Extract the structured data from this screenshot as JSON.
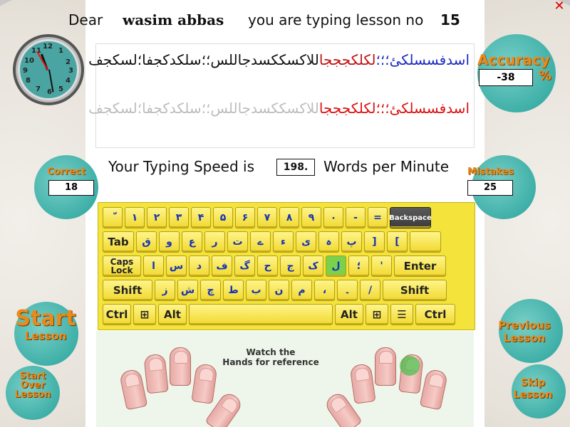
{
  "header": {
    "dear": "Dear",
    "user_name": "wasim abbas",
    "you_are": "you are typing lesson no",
    "lesson_number": "15"
  },
  "window": {
    "close_icon": "close-icon"
  },
  "text_panel": {
    "typed_blue": "اسدفسسلکئ؛؛؛",
    "typed_red": "لکلکجججا",
    "typed_black": "للاکسککسدجاللس؛؛سلکدکجفا؛لسکجف",
    "source_red": "اسدفسسلکئ؛؛؛لکلکجججا",
    "source_grey": "للاکسککسدجاللس؛؛سلکدکجفا؛لسکجف"
  },
  "speed": {
    "label": "Your Typing Speed is",
    "value": "198.",
    "unit": "Words per Minute"
  },
  "accuracy": {
    "label": "Accuracy",
    "value": "-38",
    "percent": "%"
  },
  "correct": {
    "label": "Correct",
    "value": "18"
  },
  "mistakes": {
    "label": "Mistakes",
    "value": "25"
  },
  "keyboard": {
    "backspace": "Backspace",
    "tab": "Tab",
    "caps1": "Caps",
    "caps2": "Lock",
    "enter": "Enter",
    "shift": "Shift",
    "ctrl": "Ctrl",
    "alt": "Alt",
    "row1": [
      "ّ",
      "۱",
      "۲",
      "۳",
      "۴",
      "۵",
      "۶",
      "۷",
      "۸",
      "۹",
      "۰",
      "-",
      "="
    ],
    "row2": [
      "ق",
      "و",
      "ع",
      "ر",
      "ت",
      "ے",
      "ء",
      "ی",
      "ہ",
      "پ",
      "]",
      "["
    ],
    "row3": [
      "ا",
      "س",
      "د",
      "ف",
      "گ",
      "ح",
      "ج",
      "ک",
      "ل",
      "؛",
      "'"
    ],
    "row4": [
      "ز",
      "ش",
      "چ",
      "ط",
      "ب",
      "ن",
      "م",
      "،",
      "۔",
      "/"
    ]
  },
  "hands": {
    "line1": "Watch the",
    "line2": "Hands for reference"
  },
  "buttons": {
    "start_big": "Start",
    "start_small": "Lesson",
    "startover1": "Start",
    "startover2": "Over",
    "startover3": "Lesson",
    "previous1": "Previous",
    "previous2": "Lesson",
    "skip1": "Skip",
    "skip2": "Lesson"
  },
  "clock": {
    "numbers": [
      "12",
      "1",
      "2",
      "3",
      "4",
      "5",
      "6",
      "7",
      "8",
      "9",
      "10",
      "11"
    ]
  },
  "colors": {
    "orange_text": "#e98a1d",
    "teal_bubble": "#3fb0a8",
    "keyboard_yellow": "#f3e33a"
  }
}
